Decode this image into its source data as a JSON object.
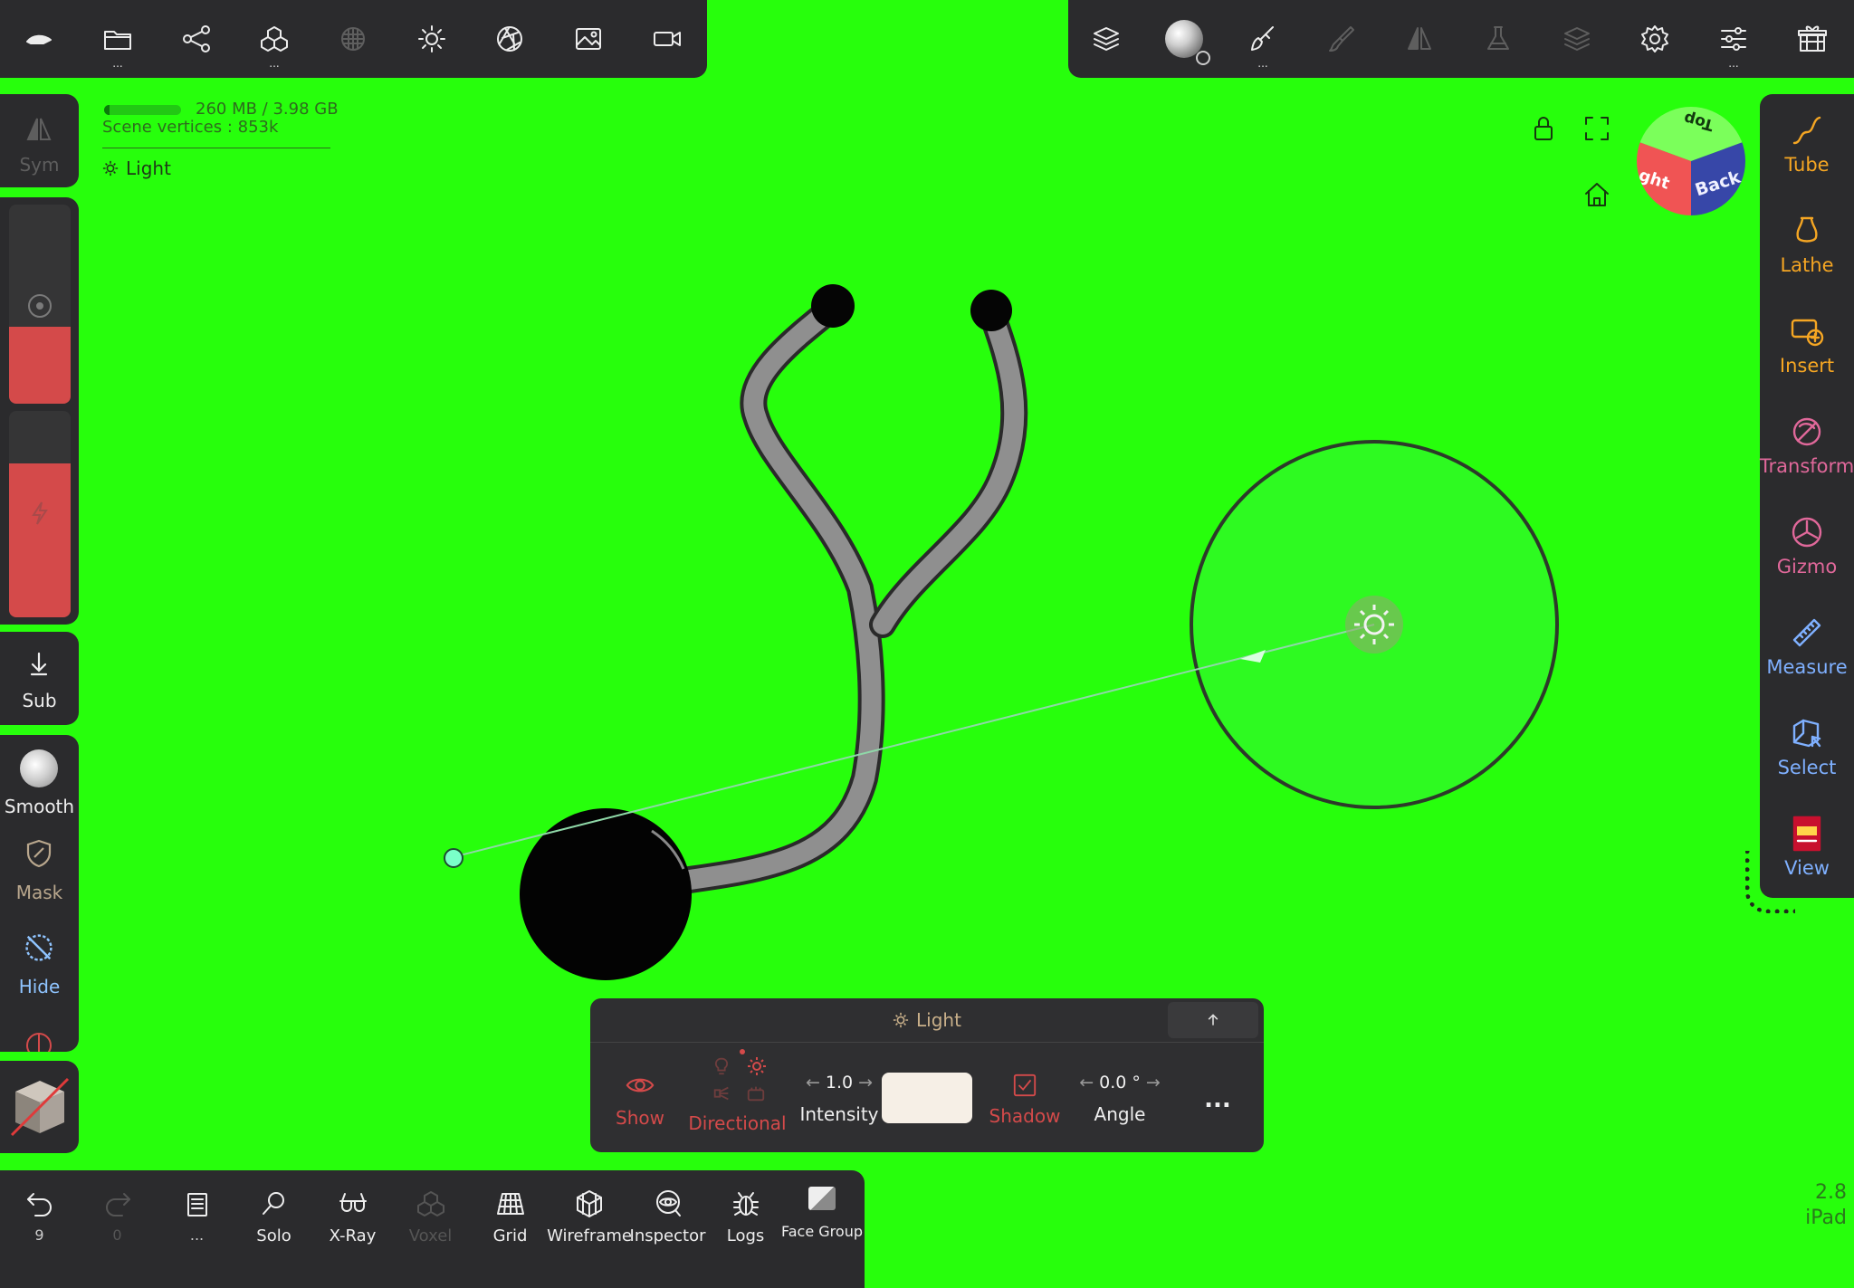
{
  "stats": {
    "memory": "260 MB / 3.98 GB",
    "memory_fill": 0.07,
    "vertices": "Scene vertices : 853k"
  },
  "context": {
    "label": "Light"
  },
  "left_tools": {
    "sym": "Sym",
    "sub": "Sub",
    "smooth": "Smooth",
    "mask": "Mask",
    "hide": "Hide"
  },
  "right_tools": [
    {
      "label": "Tube",
      "icon": "tube-icon",
      "color": "#f5a623"
    },
    {
      "label": "Lathe",
      "icon": "lathe-icon",
      "color": "#f5a623"
    },
    {
      "label": "Insert",
      "icon": "insert-icon",
      "color": "#f5a623"
    },
    {
      "label": "Transform",
      "icon": "transform-icon",
      "color": "#e0689a"
    },
    {
      "label": "Gizmo",
      "icon": "gizmo-icon",
      "color": "#e0689a"
    },
    {
      "label": "Measure",
      "icon": "measure-icon",
      "color": "#7fb0ff"
    },
    {
      "label": "Select",
      "icon": "select-icon",
      "color": "#7fb0ff"
    },
    {
      "label": "View",
      "icon": "view-icon",
      "color": "#7fb0ff"
    }
  ],
  "view_cube": {
    "top": "Top",
    "back": "Back",
    "right": "ght"
  },
  "light_panel": {
    "title": "Light",
    "show": "Show",
    "directional": "Directional",
    "intensity_value": "1.0",
    "intensity": "Intensity",
    "shadow": "Shadow",
    "angle_value": "0.0 °",
    "angle": "Angle",
    "more": "..."
  },
  "bottom_bar": {
    "undo_count": "9",
    "redo_count": "0",
    "more_label": "...",
    "items": [
      "Solo",
      "X-Ray",
      "Voxel",
      "Grid",
      "Wireframe",
      "Inspector",
      "Logs",
      "Face Group"
    ]
  },
  "version": {
    "number": "2.8",
    "device": "iPad"
  },
  "colors": {
    "background": "#27ff0c",
    "panel": "#2b2b2d",
    "accent_red": "#d44a4a",
    "accent_orange": "#f5a623",
    "accent_blue": "#7fb0ff"
  }
}
